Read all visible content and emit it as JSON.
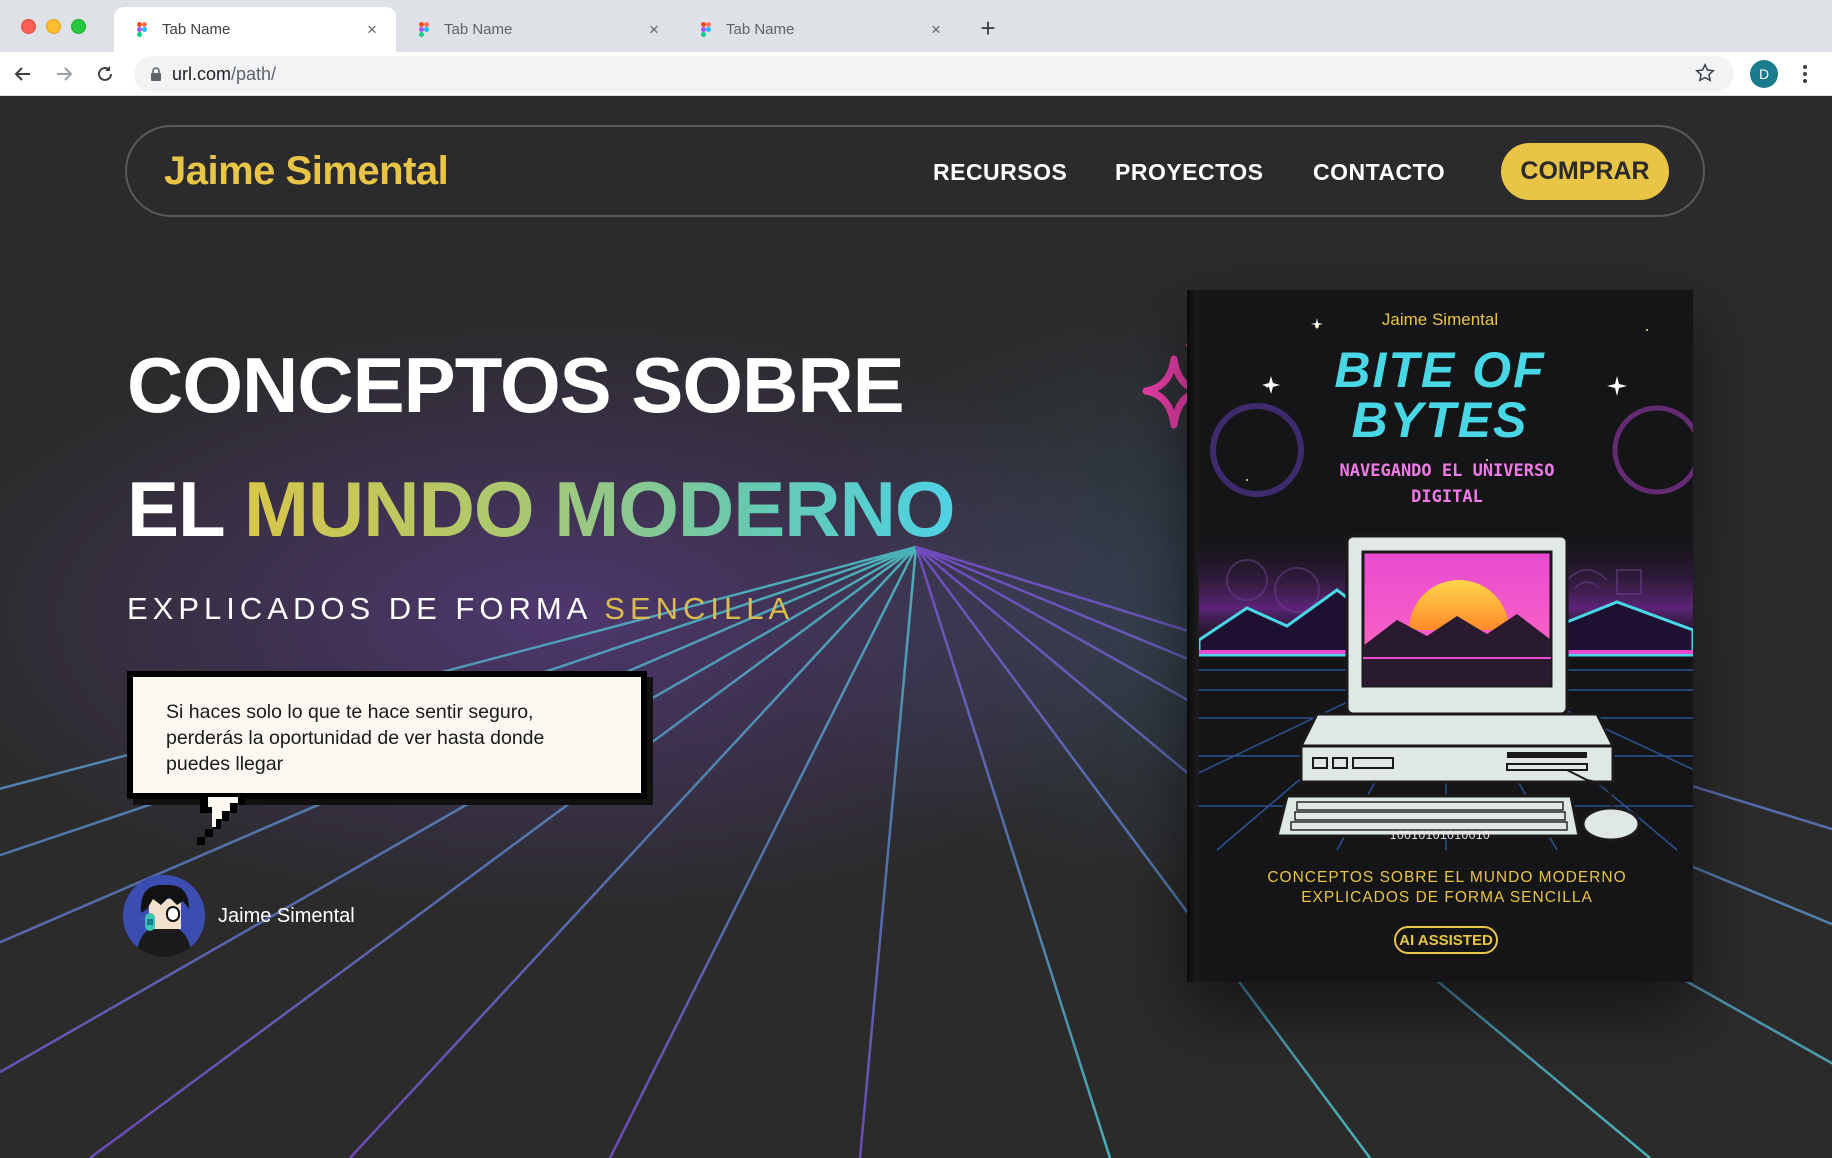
{
  "browser": {
    "tabs": [
      {
        "title": "Tab Name",
        "active": true
      },
      {
        "title": "Tab Name",
        "active": false
      },
      {
        "title": "Tab Name",
        "active": false
      }
    ],
    "url_main": "url.com",
    "url_path": "/path/",
    "profile_initial": "D",
    "new_tab_symbol": "+",
    "close_symbol": "×"
  },
  "nav": {
    "brand": "Jaime Simental",
    "links": [
      "RECURSOS",
      "PROYECTOS",
      "CONTACTO"
    ],
    "buy_label": "COMPRAR"
  },
  "hero": {
    "line1": "CONCEPTOS SOBRE",
    "line2_plain": "EL ",
    "line2_gradient": "MUNDO MODERNO",
    "subtitle_plain": "EXPLICADOS DE FORMA ",
    "subtitle_highlight": "SENCILLA"
  },
  "quote": {
    "text": "Si haces solo lo que te hace sentir seguro, perderás la oportunidad de ver hasta donde puedes llegar",
    "author": "Jaime Simental"
  },
  "book": {
    "author": "Jaime Simental",
    "title_line1": "BITE OF",
    "title_line2": "BYTES",
    "subtitle_line1": "NAVEGANDO EL UNIVERSO",
    "subtitle_line2": "DIGITAL",
    "binary": "10010101010010",
    "tagline_line1": "CONCEPTOS SOBRE EL MUNDO MODERNO",
    "tagline_line2": "EXPLICADOS DE FORMA SENCILLA",
    "badge": "AI ASSISTED"
  },
  "colors": {
    "accent_yellow": "#e8c547",
    "page_bg": "#2b2b2c",
    "grid_purple": "#7a4fd0",
    "book_cyan": "#49d6e5",
    "book_pink": "#f07be6",
    "sparkle_pink": "#e83ea8"
  },
  "icons": [
    "figma-favicon",
    "back-arrow-icon",
    "forward-arrow-icon",
    "reload-icon",
    "lock-icon",
    "bookmark-star-icon",
    "kebab-menu-icon",
    "sparkle-icon",
    "computer-illustration"
  ]
}
